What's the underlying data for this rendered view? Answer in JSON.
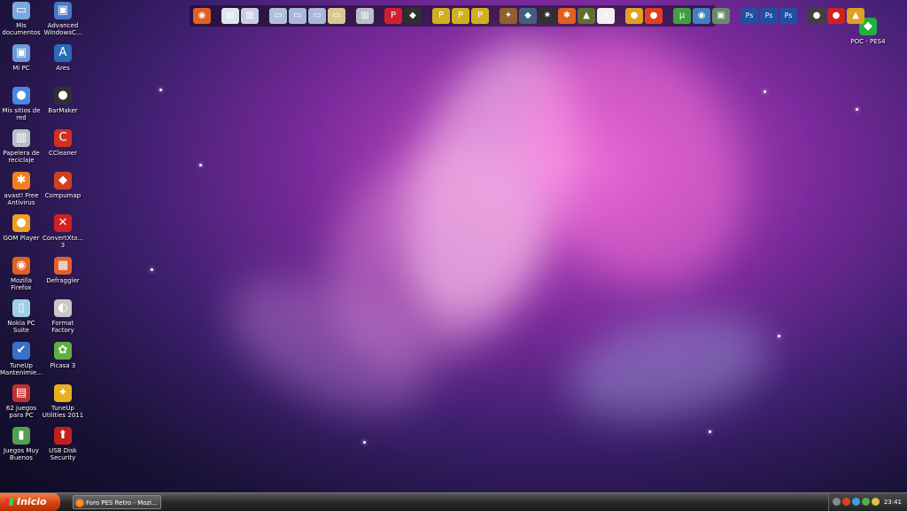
{
  "desktop": {
    "icons_left": [
      {
        "label": "Mis documentos",
        "icon": "folder-documents-icon",
        "color": "#7aa8e0",
        "glyph": "▭"
      },
      {
        "label": "Mi PC",
        "icon": "computer-icon",
        "color": "#6a9ad8",
        "glyph": "▣"
      },
      {
        "label": "Mis sitios de red",
        "icon": "network-globe-icon",
        "color": "#4a88e0",
        "glyph": "●"
      },
      {
        "label": "Papelera de reciclaje",
        "icon": "recycle-bin-icon",
        "color": "#b8c0c8",
        "glyph": "▥"
      },
      {
        "label": "avast! Free Antivirus",
        "icon": "avast-icon",
        "color": "#f08020",
        "glyph": "✱"
      },
      {
        "label": "GOM Player",
        "icon": "gom-player-icon",
        "color": "#f0a020",
        "glyph": "●"
      },
      {
        "label": "Mozilla Firefox",
        "icon": "firefox-icon",
        "color": "#e06020",
        "glyph": "◉"
      },
      {
        "label": "Nokia PC Suite",
        "icon": "nokia-icon",
        "color": "#a0d0e8",
        "glyph": "▯"
      },
      {
        "label": "TuneUp Mantenimie...",
        "icon": "tuneup-maintenance-icon",
        "color": "#3a70c8",
        "glyph": "✔"
      },
      {
        "label": "62 juegos para PC",
        "icon": "games-folder-icon",
        "color": "#c03030",
        "glyph": "▤"
      },
      {
        "label": "Juegos Muy Buenos",
        "icon": "games-archive-icon",
        "color": "#50a050",
        "glyph": "▮"
      }
    ],
    "icons_right_col": [
      {
        "label": "Advanced WindowsC...",
        "icon": "advanced-windowscare-icon",
        "color": "#4878c8",
        "glyph": "▣"
      },
      {
        "label": "Ares",
        "icon": "ares-icon",
        "color": "#2a6ab8",
        "glyph": "A"
      },
      {
        "label": "BarMaker",
        "icon": "barmaker-icon",
        "color": "#303030",
        "glyph": "●"
      },
      {
        "label": "CCleaner",
        "icon": "ccleaner-icon",
        "color": "#d03020",
        "glyph": "C"
      },
      {
        "label": "Compumap",
        "icon": "compumap-icon",
        "color": "#d04020",
        "glyph": "◆"
      },
      {
        "label": "ConvertXto... 3",
        "icon": "convertxto-icon",
        "color": "#d02020",
        "glyph": "✕"
      },
      {
        "label": "Defraggler",
        "icon": "defraggler-icon",
        "color": "#e06030",
        "glyph": "▦"
      },
      {
        "label": "Format Factory",
        "icon": "format-factory-icon",
        "color": "#c8c8c8",
        "glyph": "◐"
      },
      {
        "label": "Picasa 3",
        "icon": "picasa-icon",
        "color": "#60b040",
        "glyph": "✿"
      },
      {
        "label": "TuneUp Utilities 2011",
        "icon": "tuneup-utilities-icon",
        "color": "#e8b020",
        "glyph": "✦"
      },
      {
        "label": "USB Disk Security",
        "icon": "usb-disk-security-icon",
        "color": "#c02020",
        "glyph": "⬆"
      }
    ],
    "icon_top_right": {
      "label": "POC - PES4",
      "icon": "poc-pes4-icon",
      "color": "#20b040",
      "glyph": "◆"
    }
  },
  "topbar": {
    "items": [
      {
        "icon": "firefox-launch-icon",
        "color": "#e06020",
        "glyph": "◉"
      },
      {
        "icon": "sep",
        "color": "",
        "glyph": ""
      },
      {
        "icon": "windows-launch-icon",
        "color": "#dde4ee",
        "glyph": "▤"
      },
      {
        "icon": "explorer-launch-icon",
        "color": "#c8d0e0",
        "glyph": "▥"
      },
      {
        "icon": "sep",
        "color": "",
        "glyph": ""
      },
      {
        "icon": "folder-launch-icon-1",
        "color": "#b0c0d8",
        "glyph": "▭"
      },
      {
        "icon": "folder-launch-icon-2",
        "color": "#a8b8d8",
        "glyph": "▭"
      },
      {
        "icon": "folder-launch-icon-3",
        "color": "#a8b8d8",
        "glyph": "▭"
      },
      {
        "icon": "folder-launch-icon-4",
        "color": "#d8c890",
        "glyph": "▭"
      },
      {
        "icon": "sep",
        "color": "",
        "glyph": ""
      },
      {
        "icon": "recycle-launch-icon",
        "color": "#b8c0c8",
        "glyph": "▥"
      },
      {
        "icon": "sep",
        "color": "",
        "glyph": ""
      },
      {
        "icon": "pes-launch-icon",
        "color": "#d02030",
        "glyph": "P"
      },
      {
        "icon": "shield-launch-icon",
        "color": "#303030",
        "glyph": "◆"
      },
      {
        "icon": "sep",
        "color": "",
        "glyph": ""
      },
      {
        "icon": "pes-game-icon-1",
        "color": "#d0b020",
        "glyph": "P"
      },
      {
        "icon": "pes-game-icon-2",
        "color": "#d0b020",
        "glyph": "P"
      },
      {
        "icon": "pes-game-icon-3",
        "color": "#d0b020",
        "glyph": "P"
      },
      {
        "icon": "sep",
        "color": "",
        "glyph": ""
      },
      {
        "icon": "game-icon-1",
        "color": "#906030",
        "glyph": "✦"
      },
      {
        "icon": "game-icon-2",
        "color": "#406080",
        "glyph": "◆"
      },
      {
        "icon": "game-icon-3",
        "color": "#303030",
        "glyph": "✷"
      },
      {
        "icon": "game-icon-4",
        "color": "#e06020",
        "glyph": "✱"
      },
      {
        "icon": "game-icon-5",
        "color": "#607030",
        "glyph": "▲"
      },
      {
        "icon": "game-icon-6",
        "color": "#f0f0f0",
        "glyph": "B"
      },
      {
        "icon": "sep",
        "color": "",
        "glyph": ""
      },
      {
        "icon": "tool-icon-1",
        "color": "#e0a020",
        "glyph": "●"
      },
      {
        "icon": "tool-icon-2",
        "color": "#e04020",
        "glyph": "●"
      },
      {
        "icon": "sep",
        "color": "",
        "glyph": ""
      },
      {
        "icon": "utorrent-icon",
        "color": "#40a040",
        "glyph": "µ"
      },
      {
        "icon": "tool-icon-3",
        "color": "#4080c0",
        "glyph": "◉"
      },
      {
        "icon": "tool-icon-4",
        "color": "#6a8a6a",
        "glyph": "▣"
      },
      {
        "icon": "sep",
        "color": "",
        "glyph": ""
      },
      {
        "icon": "photoshop-icon-1",
        "color": "#2050a0",
        "glyph": "Ps"
      },
      {
        "icon": "photoshop-icon-2",
        "color": "#2050a0",
        "glyph": "Ps"
      },
      {
        "icon": "photoshop-icon-3",
        "color": "#2050a0",
        "glyph": "Ps"
      },
      {
        "icon": "sep",
        "color": "",
        "glyph": ""
      },
      {
        "icon": "tool-icon-5",
        "color": "#404040",
        "glyph": "●"
      },
      {
        "icon": "tool-icon-6",
        "color": "#d02020",
        "glyph": "●"
      },
      {
        "icon": "tool-icon-7",
        "color": "#e0a020",
        "glyph": "▲"
      }
    ]
  },
  "taskbar": {
    "start_label": "Inicio",
    "active_task": "Foro PES Retro - Mozi...",
    "clock": "23:41"
  }
}
